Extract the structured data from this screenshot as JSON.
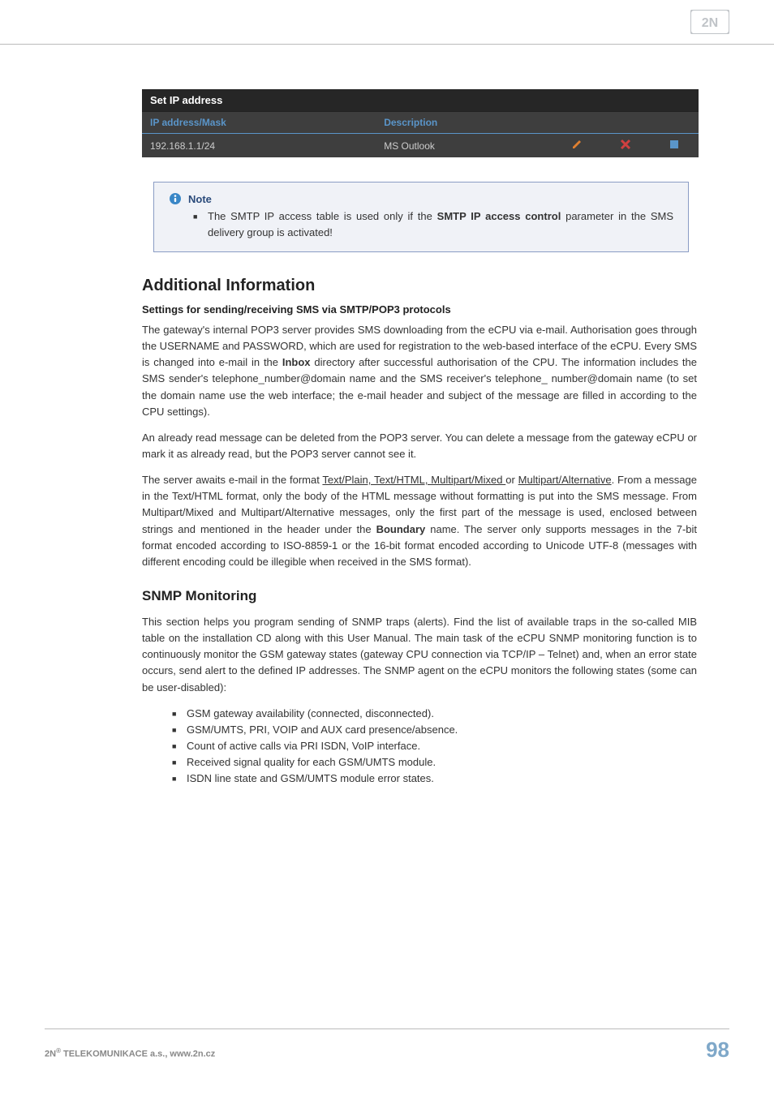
{
  "table": {
    "title": "Set IP address",
    "col1": "IP address/Mask",
    "col2": "Description",
    "row1_col1": "192.168.1.1/24",
    "row1_col2": "MS Outlook"
  },
  "note": {
    "label": "Note",
    "item_pre": "The SMTP IP access table is used only if the ",
    "item_bold": "SMTP IP access control",
    "item_post": " parameter in the SMS delivery group is activated!"
  },
  "headings": {
    "additional": "Additional Information",
    "settings": "Settings for sending/receiving SMS via SMTP/POP3 protocols",
    "snmp": "SNMP Monitoring"
  },
  "para1_pre": "The gateway's internal POP3 server provides SMS downloading from the eCPU via e-mail. Authorisation goes through the USERNAME and PASSWORD, which are used for registration to the web-based interface of the eCPU. Every SMS is changed into e-mail in the ",
  "para1_bold": "Inbox",
  "para1_post": " directory after successful authorisation of the CPU. The information includes the SMS sender's telephone_number@domain name and the SMS receiver's telephone_ number@domain name (to set the domain name use the web interface; the e-mail header and subject of the message are filled in according to the CPU settings).",
  "para2": "An already read message can be deleted from the POP3 server. You can delete a message from the gateway eCPU or mark it as already read, but the POP3 server cannot see it.",
  "para3_pre": "The server awaits e-mail in the format ",
  "para3_u1": "Text/Plain, Text/HTML, Multipart/Mixed ",
  "para3_mid1": "or ",
  "para3_u2": "Multipart/Alternative",
  "para3_mid2": ". From a message in the Text/HTML format, only the body of the HTML message without formatting is put into the SMS message. From Multipart/Mixed and Multipart/Alternative messages, only the first part of the message is used, enclosed between strings and mentioned in the header under the ",
  "para3_bold": "Boundary",
  "para3_post": " name. The server only supports messages in the 7-bit format encoded according to ISO-8859-1 or the 16-bit format encoded according to Unicode UTF-8 (messages with different encoding could be illegible when received in the SMS format).",
  "para4": "This section helps you program sending of SNMP traps (alerts). Find the list of available traps in the so-called MIB table on the installation CD along with this User Manual. The main task of the eCPU SNMP monitoring function is to continuously monitor the GSM gateway states (gateway CPU connection via TCP/IP – Telnet) and, when an error state occurs, send alert to the defined IP addresses. The SNMP agent on the eCPU monitors the following states (some can be user-disabled):",
  "states": [
    "GSM gateway availability (connected, disconnected).",
    "GSM/UMTS, PRI, VOIP and AUX card presence/absence.",
    "Count of active calls via PRI ISDN, VoIP interface.",
    "Received signal quality for each GSM/UMTS module.",
    "ISDN line state and GSM/UMTS module error states."
  ],
  "footer": {
    "company_prefix": "2N",
    "company_suffix": " TELEKOMUNIKACE a.s., www.2n.cz",
    "page": "98"
  }
}
